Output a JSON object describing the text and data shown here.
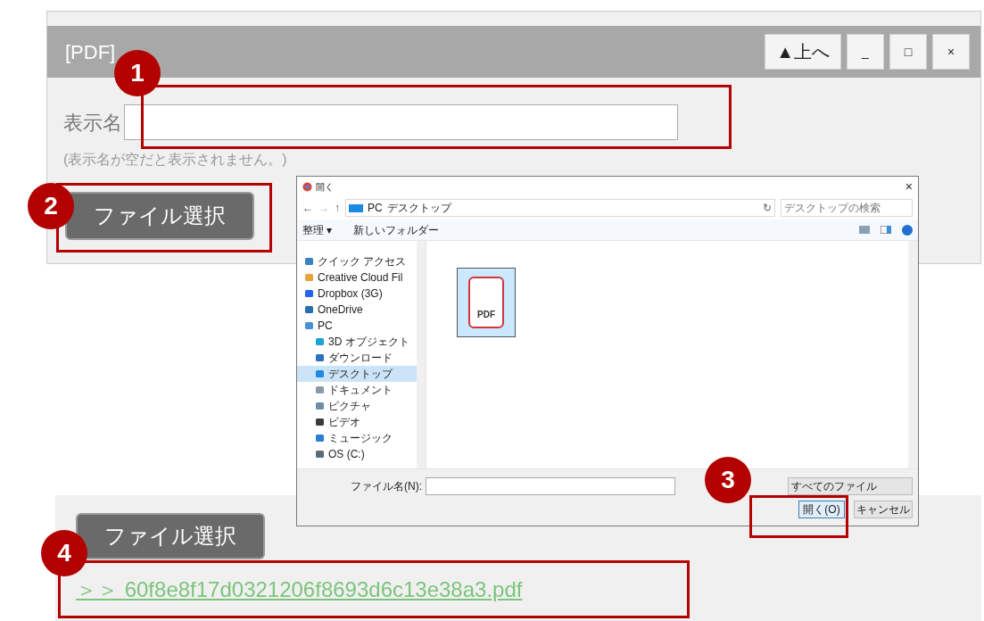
{
  "panel": {
    "title": "[PDF]",
    "header_buttons": [
      "▲上へ",
      "_",
      "□",
      "×"
    ],
    "display_name_label": "表示名",
    "note": "(表示名が空だと表示されません。)",
    "file_button": "ファイル選択"
  },
  "dialog": {
    "title": "開く",
    "close": "×",
    "nav_buttons": [
      "←",
      "→",
      "↑"
    ],
    "refresh": "↻",
    "path": [
      "PC",
      "デスクトップ"
    ],
    "search": {
      "placeholder": "デスクトップの検索"
    },
    "toolbar": [
      "整理 ▾",
      "新しいフォルダー"
    ],
    "nav": [
      {
        "label": "クイック アクセス",
        "selected": false
      },
      {
        "label": "Creative Cloud Fil",
        "selected": false
      },
      {
        "label": "Dropbox (3G)",
        "selected": false
      },
      {
        "label": "OneDrive",
        "selected": false
      },
      {
        "label": "PC",
        "selected": false,
        "children": [
          {
            "label": "3D オブジェクト",
            "selected": false
          },
          {
            "label": "ダウンロード",
            "selected": false
          },
          {
            "label": "デスクトップ",
            "selected": true
          },
          {
            "label": "ドキュメント",
            "selected": false
          },
          {
            "label": "ピクチャ",
            "selected": false
          },
          {
            "label": "ビデオ",
            "selected": false
          },
          {
            "label": "ミュージック",
            "selected": false
          },
          {
            "label": "OS (C:)",
            "selected": false
          }
        ]
      }
    ],
    "files": [
      {
        "label": "PDF",
        "selected": true
      }
    ],
    "filename_label": "ファイル名(N):",
    "filetype": "すべてのファイル",
    "open_button": "開く(O)",
    "cancel_button": "キャンセル"
  },
  "result": {
    "file_button": "ファイル選択",
    "link": "＞＞ 60f8e8f17d0321206f8693d6c13e38a3.pdf"
  },
  "callouts": [
    "1",
    "2",
    "3",
    "4"
  ]
}
